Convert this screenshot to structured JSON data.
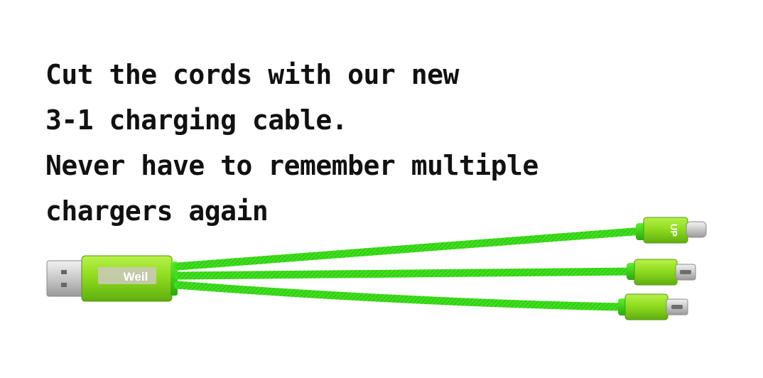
{
  "ad": {
    "headline_lines": [
      "Cut the cords with our new",
      "3-1 charging cable.",
      "Never have to remember multiple",
      "chargers again"
    ]
  },
  "product": {
    "usb_logo_text": "Weil",
    "lightning_logo_text": "UP",
    "cable_color": "#3ee01c",
    "housing_color": "#8fdc1e"
  }
}
